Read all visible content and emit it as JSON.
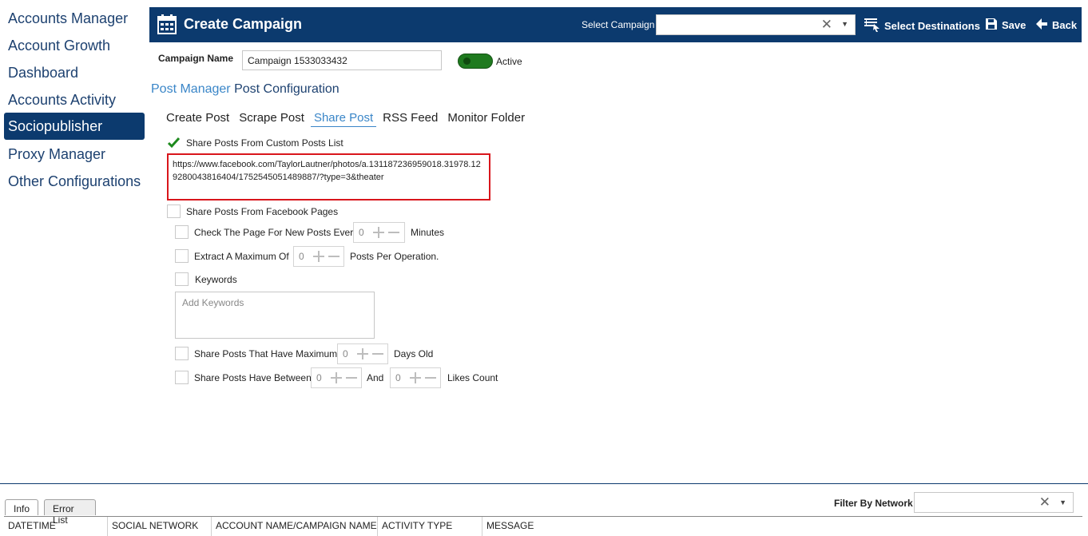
{
  "sidebar": {
    "items": [
      {
        "label": "Accounts Manager",
        "active": false
      },
      {
        "label": "Account Growth",
        "active": false
      },
      {
        "label": "Dashboard",
        "active": false
      },
      {
        "label": "Accounts Activity",
        "active": false
      },
      {
        "label": "Sociopublisher",
        "active": true
      },
      {
        "label": "Proxy Manager",
        "active": false
      },
      {
        "label": "Other Configurations",
        "active": false
      }
    ]
  },
  "header": {
    "title": "Create Campaign",
    "select_campaign_label": "Select Campaign",
    "select_campaign_value": "",
    "select_destinations_label": "Select Destinations",
    "save_label": "Save",
    "back_label": "Back"
  },
  "campaign": {
    "name_label": "Campaign Name",
    "name_value": "Campaign 1533033432",
    "active_label": "Active",
    "active": true
  },
  "breadcrumb": {
    "link": "Post Manager",
    "current": "Post Configuration"
  },
  "tabs": [
    {
      "label": "Create Post",
      "active": false
    },
    {
      "label": "Scrape Post",
      "active": false
    },
    {
      "label": "Share Post",
      "active": true
    },
    {
      "label": "RSS Feed",
      "active": false
    },
    {
      "label": "Monitor Folder",
      "active": false
    }
  ],
  "share": {
    "custom_list_label": "Share Posts From Custom Posts List",
    "custom_list_checked": true,
    "custom_list_url": "https://www.facebook.com/TaylorLautner/photos/a.131187236959018.31978.129280043816404/1752545051489887/?type=3&theater",
    "fb_pages_label": "Share Posts From Facebook Pages",
    "fb_pages_checked": false,
    "check_every_label": "Check The Page For New Posts Every",
    "check_every_value": "0",
    "check_every_unit": "Minutes",
    "extract_max_label": "Extract A Maximum Of",
    "extract_max_value": "0",
    "extract_max_unit": "Posts Per Operation.",
    "keywords_label": "Keywords",
    "keywords_placeholder": "Add Keywords",
    "max_days_label": "Share Posts That Have Maximum",
    "max_days_value": "0",
    "max_days_unit": "Days Old",
    "between_label": "Share Posts Have Between",
    "between_min": "0",
    "between_and": "And",
    "between_max": "0",
    "between_unit": "Likes Count"
  },
  "bottom": {
    "tabs": [
      "Info",
      "Error List"
    ],
    "filter_label": "Filter By Network",
    "filter_value": "",
    "columns": [
      "DATETIME",
      "SOCIAL NETWORK",
      "ACCOUNT NAME/CAMPAIGN NAME",
      "ACTIVITY TYPE",
      "MESSAGE"
    ]
  },
  "colors": {
    "header_bg": "#0c3a6e",
    "accent": "#3a86c8",
    "highlight_border": "#d9161c",
    "toggle_on": "#1f7a1f"
  },
  "icons": {
    "header": "calendar-icon",
    "destinations": "destinations-list-icon",
    "save": "floppy-disk-icon",
    "back": "arrow-left-icon"
  }
}
